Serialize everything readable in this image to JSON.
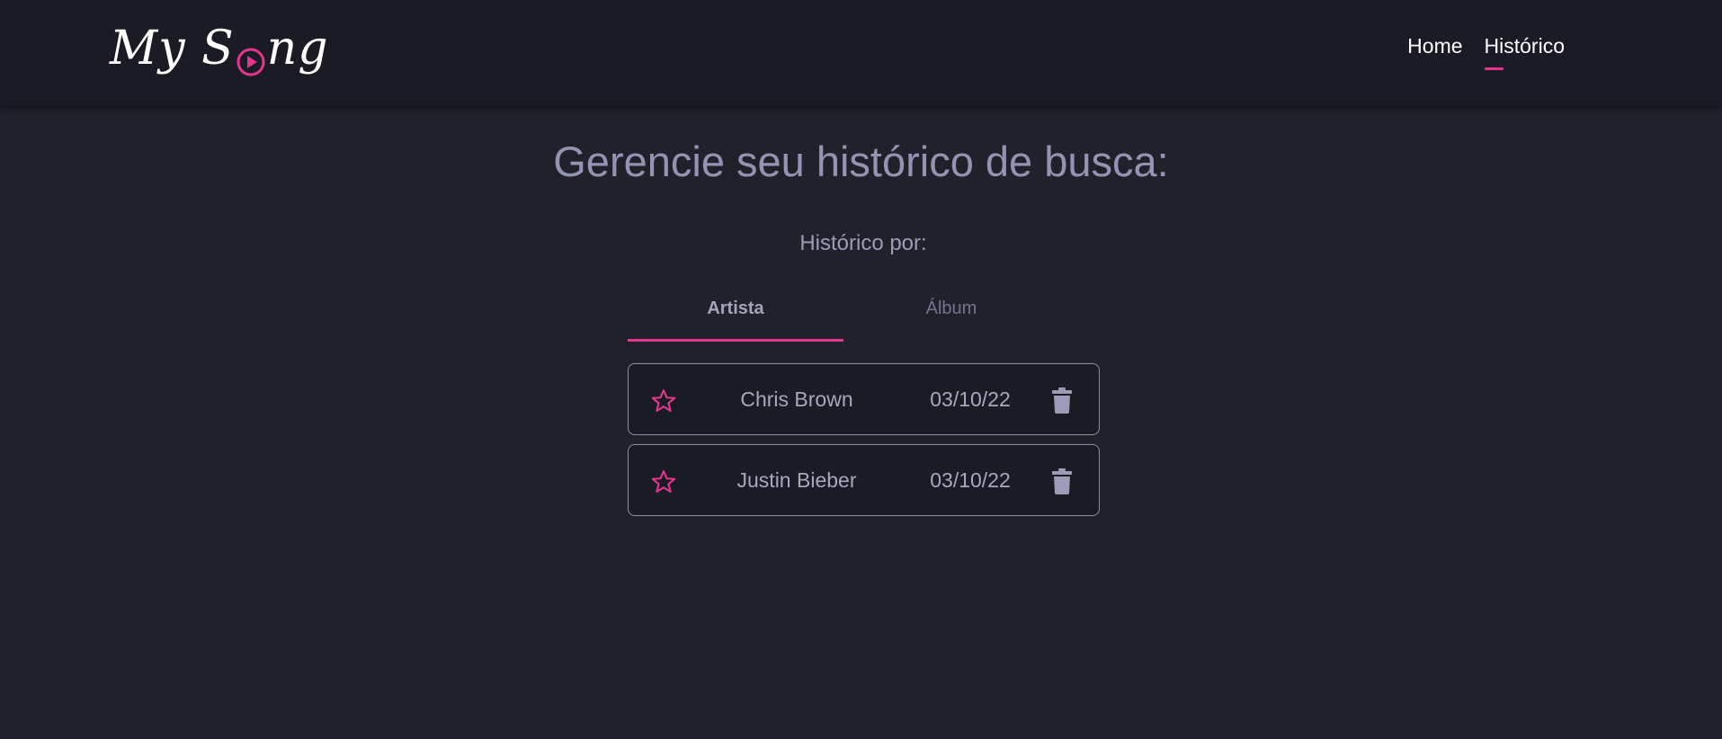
{
  "header": {
    "logo": {
      "part1": "My S",
      "part2": "ng"
    },
    "nav": [
      {
        "label": "Home",
        "active": false
      },
      {
        "label": "Histórico",
        "active": true
      }
    ]
  },
  "main": {
    "title": "Gerencie seu histórico de busca:",
    "subtitle": "Histórico por:",
    "tabs": [
      {
        "label": "Artista",
        "active": true
      },
      {
        "label": "Álbum",
        "active": false
      }
    ],
    "history": [
      {
        "name": "Chris Brown",
        "date": "03/10/22",
        "star_icon": "star-outline-icon",
        "delete_icon": "trash-icon"
      },
      {
        "name": "Justin Bieber",
        "date": "03/10/22",
        "star_icon": "star-outline-icon",
        "delete_icon": "trash-icon"
      }
    ]
  },
  "colors": {
    "accent": "#e5358e",
    "background": "#21212c",
    "header_bg": "#1a1b25",
    "muted_text": "#9294b3"
  }
}
